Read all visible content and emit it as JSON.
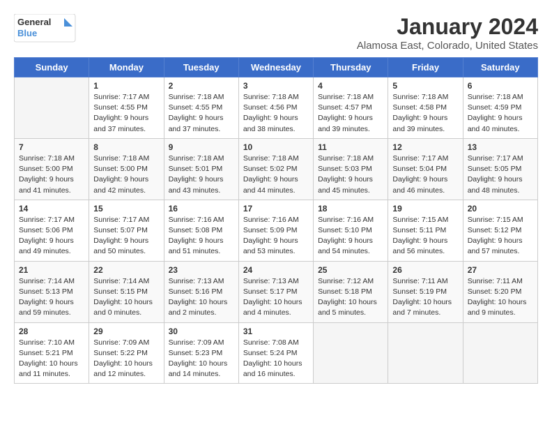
{
  "logo": {
    "line1": "General",
    "line2": "Blue"
  },
  "title": "January 2024",
  "subtitle": "Alamosa East, Colorado, United States",
  "weekdays": [
    "Sunday",
    "Monday",
    "Tuesday",
    "Wednesday",
    "Thursday",
    "Friday",
    "Saturday"
  ],
  "weeks": [
    [
      {
        "day": "",
        "info": ""
      },
      {
        "day": "1",
        "info": "Sunrise: 7:17 AM\nSunset: 4:55 PM\nDaylight: 9 hours\nand 37 minutes."
      },
      {
        "day": "2",
        "info": "Sunrise: 7:18 AM\nSunset: 4:55 PM\nDaylight: 9 hours\nand 37 minutes."
      },
      {
        "day": "3",
        "info": "Sunrise: 7:18 AM\nSunset: 4:56 PM\nDaylight: 9 hours\nand 38 minutes."
      },
      {
        "day": "4",
        "info": "Sunrise: 7:18 AM\nSunset: 4:57 PM\nDaylight: 9 hours\nand 39 minutes."
      },
      {
        "day": "5",
        "info": "Sunrise: 7:18 AM\nSunset: 4:58 PM\nDaylight: 9 hours\nand 39 minutes."
      },
      {
        "day": "6",
        "info": "Sunrise: 7:18 AM\nSunset: 4:59 PM\nDaylight: 9 hours\nand 40 minutes."
      }
    ],
    [
      {
        "day": "7",
        "info": "Sunrise: 7:18 AM\nSunset: 5:00 PM\nDaylight: 9 hours\nand 41 minutes."
      },
      {
        "day": "8",
        "info": "Sunrise: 7:18 AM\nSunset: 5:00 PM\nDaylight: 9 hours\nand 42 minutes."
      },
      {
        "day": "9",
        "info": "Sunrise: 7:18 AM\nSunset: 5:01 PM\nDaylight: 9 hours\nand 43 minutes."
      },
      {
        "day": "10",
        "info": "Sunrise: 7:18 AM\nSunset: 5:02 PM\nDaylight: 9 hours\nand 44 minutes."
      },
      {
        "day": "11",
        "info": "Sunrise: 7:18 AM\nSunset: 5:03 PM\nDaylight: 9 hours\nand 45 minutes."
      },
      {
        "day": "12",
        "info": "Sunrise: 7:17 AM\nSunset: 5:04 PM\nDaylight: 9 hours\nand 46 minutes."
      },
      {
        "day": "13",
        "info": "Sunrise: 7:17 AM\nSunset: 5:05 PM\nDaylight: 9 hours\nand 48 minutes."
      }
    ],
    [
      {
        "day": "14",
        "info": "Sunrise: 7:17 AM\nSunset: 5:06 PM\nDaylight: 9 hours\nand 49 minutes."
      },
      {
        "day": "15",
        "info": "Sunrise: 7:17 AM\nSunset: 5:07 PM\nDaylight: 9 hours\nand 50 minutes."
      },
      {
        "day": "16",
        "info": "Sunrise: 7:16 AM\nSunset: 5:08 PM\nDaylight: 9 hours\nand 51 minutes."
      },
      {
        "day": "17",
        "info": "Sunrise: 7:16 AM\nSunset: 5:09 PM\nDaylight: 9 hours\nand 53 minutes."
      },
      {
        "day": "18",
        "info": "Sunrise: 7:16 AM\nSunset: 5:10 PM\nDaylight: 9 hours\nand 54 minutes."
      },
      {
        "day": "19",
        "info": "Sunrise: 7:15 AM\nSunset: 5:11 PM\nDaylight: 9 hours\nand 56 minutes."
      },
      {
        "day": "20",
        "info": "Sunrise: 7:15 AM\nSunset: 5:12 PM\nDaylight: 9 hours\nand 57 minutes."
      }
    ],
    [
      {
        "day": "21",
        "info": "Sunrise: 7:14 AM\nSunset: 5:13 PM\nDaylight: 9 hours\nand 59 minutes."
      },
      {
        "day": "22",
        "info": "Sunrise: 7:14 AM\nSunset: 5:15 PM\nDaylight: 10 hours\nand 0 minutes."
      },
      {
        "day": "23",
        "info": "Sunrise: 7:13 AM\nSunset: 5:16 PM\nDaylight: 10 hours\nand 2 minutes."
      },
      {
        "day": "24",
        "info": "Sunrise: 7:13 AM\nSunset: 5:17 PM\nDaylight: 10 hours\nand 4 minutes."
      },
      {
        "day": "25",
        "info": "Sunrise: 7:12 AM\nSunset: 5:18 PM\nDaylight: 10 hours\nand 5 minutes."
      },
      {
        "day": "26",
        "info": "Sunrise: 7:11 AM\nSunset: 5:19 PM\nDaylight: 10 hours\nand 7 minutes."
      },
      {
        "day": "27",
        "info": "Sunrise: 7:11 AM\nSunset: 5:20 PM\nDaylight: 10 hours\nand 9 minutes."
      }
    ],
    [
      {
        "day": "28",
        "info": "Sunrise: 7:10 AM\nSunset: 5:21 PM\nDaylight: 10 hours\nand 11 minutes."
      },
      {
        "day": "29",
        "info": "Sunrise: 7:09 AM\nSunset: 5:22 PM\nDaylight: 10 hours\nand 12 minutes."
      },
      {
        "day": "30",
        "info": "Sunrise: 7:09 AM\nSunset: 5:23 PM\nDaylight: 10 hours\nand 14 minutes."
      },
      {
        "day": "31",
        "info": "Sunrise: 7:08 AM\nSunset: 5:24 PM\nDaylight: 10 hours\nand 16 minutes."
      },
      {
        "day": "",
        "info": ""
      },
      {
        "day": "",
        "info": ""
      },
      {
        "day": "",
        "info": ""
      }
    ]
  ]
}
